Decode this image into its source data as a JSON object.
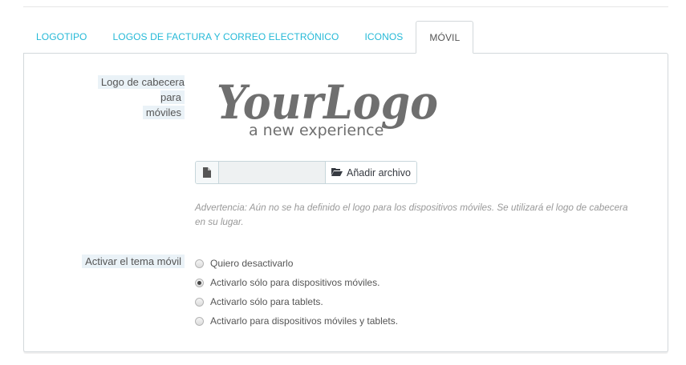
{
  "tabs": [
    {
      "label": "LOGOTIPO",
      "active": false
    },
    {
      "label": "LOGOS DE FACTURA Y CORREO ELECTRÓNICO",
      "active": false
    },
    {
      "label": "ICONOS",
      "active": false
    },
    {
      "label": "MÓVIL",
      "active": true
    }
  ],
  "mobile_logo": {
    "label_line1": "Logo de cabecera para",
    "label_line2": "móviles",
    "logo_main": "YourLogo",
    "logo_tagline": "a new experience",
    "file_icon": "file-icon",
    "add_file_label": "Añadir archivo",
    "folder_icon": "folder-open-icon",
    "warning": "Advertencia: Aún no se ha definido el logo para los dispositivos móviles. Se utilizará el logo de cabecera en su lugar."
  },
  "mobile_theme": {
    "label": "Activar el tema móvil",
    "options": [
      {
        "label": "Quiero desactivarlo",
        "checked": false
      },
      {
        "label": "Activarlo sólo para dispositivos móviles.",
        "checked": true
      },
      {
        "label": "Activarlo sólo para tablets.",
        "checked": false
      },
      {
        "label": "Activarlo para dispositivos móviles y tablets.",
        "checked": false
      }
    ]
  },
  "colors": {
    "accent": "#25b9d7",
    "label_bg": "#eaf2f7"
  }
}
